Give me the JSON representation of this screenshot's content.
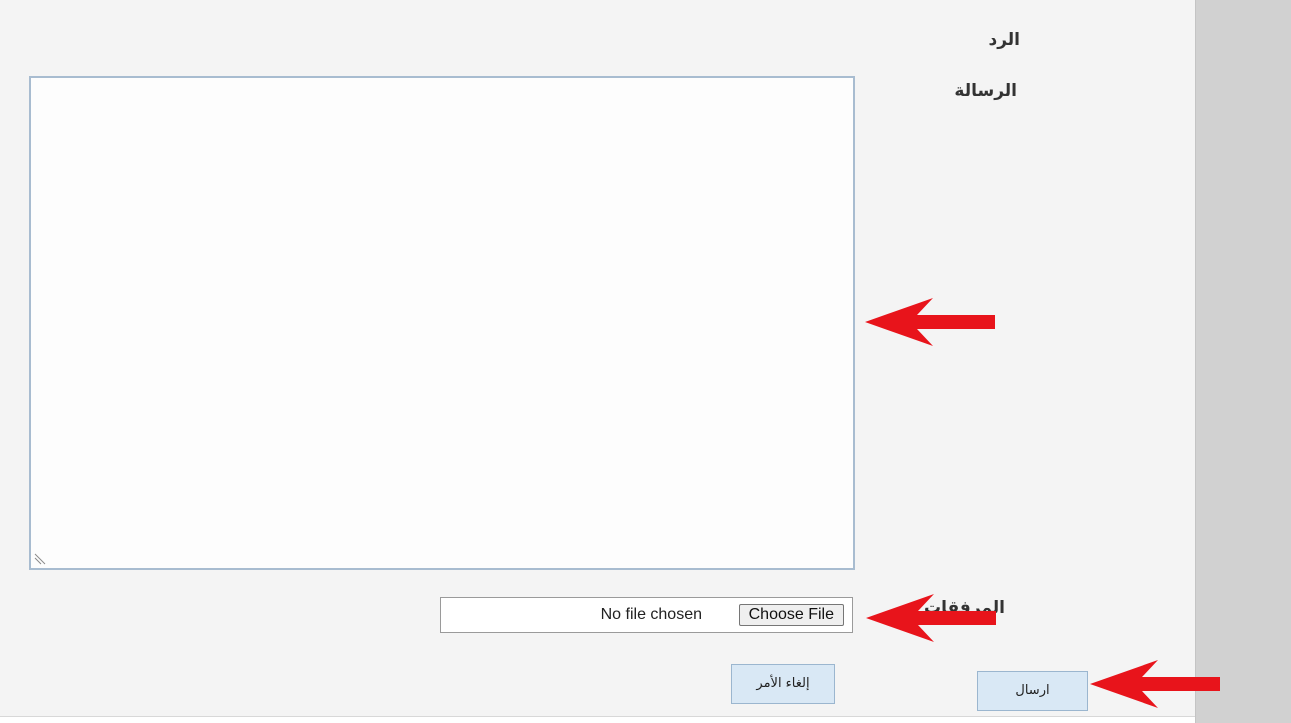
{
  "form": {
    "section_title": "الرد",
    "message_label": "الرسالة",
    "message_value": "",
    "attachments_label": "المرفقات",
    "file_input": {
      "button_label": "Choose File",
      "status_text": "No file chosen"
    }
  },
  "actions": {
    "cancel_label": "إلغاء الأمر",
    "send_label": "ارسال"
  },
  "annotations": {
    "arrow_color": "#e8141b"
  },
  "colors": {
    "panel_background": "#f4f4f4",
    "sidebar_background": "#d1d1d1",
    "button_background": "#d9e8f5",
    "textarea_border": "#a8bcd0"
  }
}
